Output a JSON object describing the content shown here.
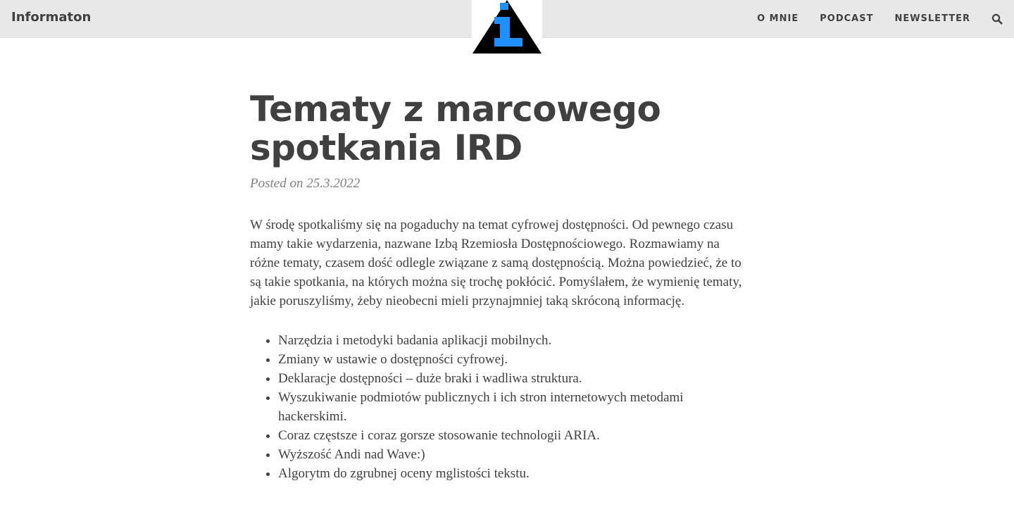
{
  "header": {
    "brand": "Informaton",
    "logo_icon": "info-triangle-icon",
    "nav": [
      {
        "label": "O MNIE"
      },
      {
        "label": "PODCAST"
      },
      {
        "label": "NEWSLETTER"
      }
    ],
    "search_icon": "search-icon"
  },
  "article": {
    "title": "Tematy z marcowego spotkania IRD",
    "posted_prefix": "Posted on",
    "date": "25.3.2022",
    "intro": "W środę spotkaliśmy się na pogaduchy na temat cyfrowej dostępności. Od pewnego czasu mamy takie wydarzenia, nazwane Izbą Rzemiosła Dostępnościowego. Rozmawiamy na różne tematy, czasem dość odlegle związane z samą dostępnością. Można powiedzieć, że to są takie spotkania, na których można się trochę pokłócić. Pomyślałem, że wymienię tematy, jakie poruszyliśmy, żeby nieobecni mieli przynajmniej taką skróconą informację.",
    "topics": [
      "Narzędzia i metodyki badania aplikacji mobilnych.",
      "Zmiany w ustawie o dostępności cyfrowej.",
      "Deklaracje dostępności – duże braki i wadliwa struktura.",
      "Wyszukiwanie podmiotów publicznych i ich stron internetowych metodami hackerskimi.",
      "Coraz częstsze i coraz gorsze stosowanie technologii ARIA.",
      "Wyższość Andi nad Wave:)",
      "Algorytm do zgrubnej oceny mglistości tekstu."
    ]
  },
  "colors": {
    "header_bg": "#e8e8e8",
    "text": "#404040",
    "meta": "#808080",
    "logo_accent": "#1e90ff"
  }
}
